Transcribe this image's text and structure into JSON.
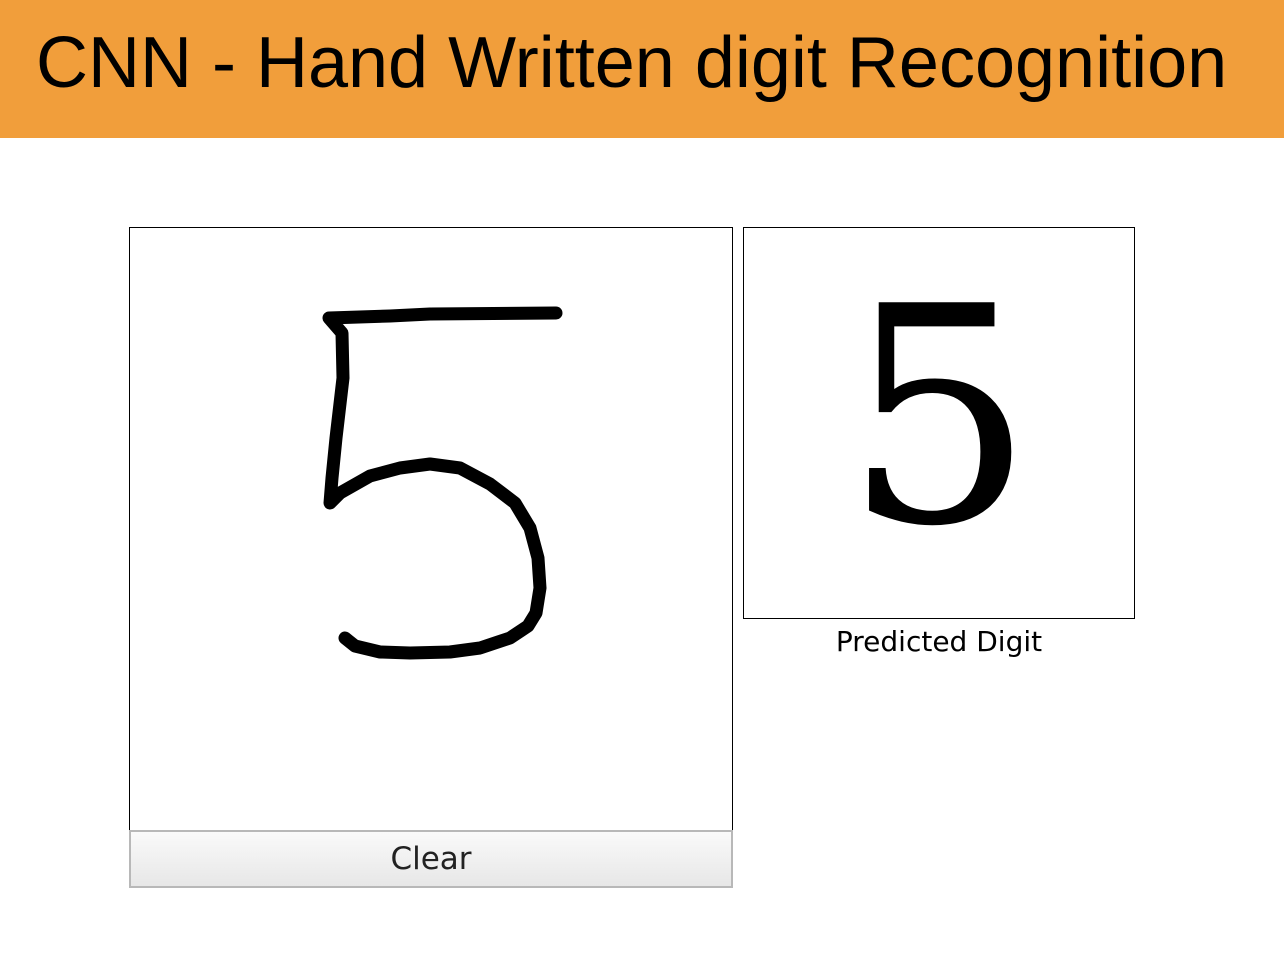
{
  "header": {
    "title": "CNN - Hand Written digit Recognition",
    "background_color": "#f19e3b"
  },
  "canvas": {
    "drawn_digit": "5",
    "clear_label": "Clear"
  },
  "prediction": {
    "value": "5",
    "label": "Predicted Digit"
  }
}
